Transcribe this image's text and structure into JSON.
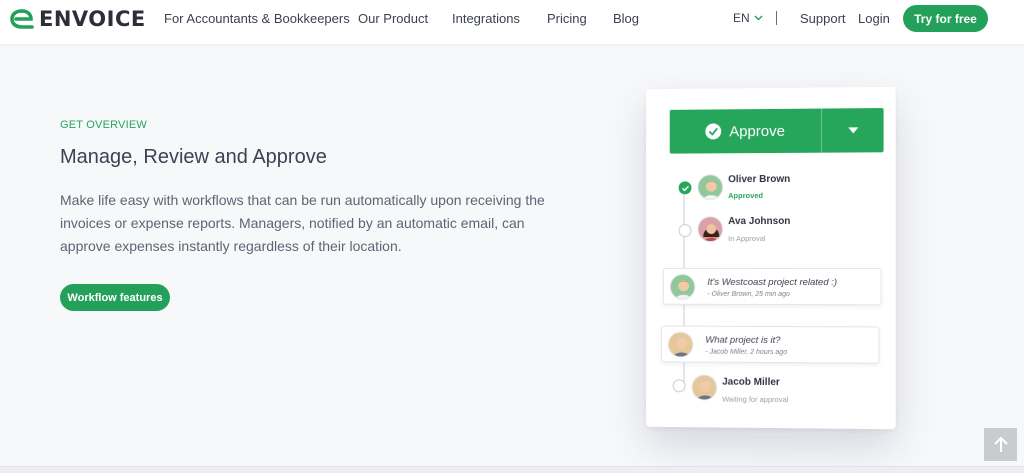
{
  "brand": {
    "name": "ENVOICE",
    "color": "#23a05a"
  },
  "nav": {
    "items": [
      "For Accountants & Bookkeepers",
      "Our Product",
      "Integrations",
      "Pricing",
      "Blog"
    ],
    "lang": "EN",
    "support": "Support",
    "login": "Login",
    "cta": "Try for free"
  },
  "hero": {
    "eyebrow": "GET OVERVIEW",
    "title": "Manage, Review and Approve",
    "description": "Make life easy with workflows that can be run automatically upon receiving the invoices or expense reports. Managers, notified by an automatic email, can approve expenses instantly regardless of their location.",
    "button": "Workflow features"
  },
  "card": {
    "approve_label": "Approve",
    "steps": [
      {
        "name": "Oliver Brown",
        "status": "Approved"
      },
      {
        "name": "Ava Johnson",
        "status": "In Approval"
      },
      {
        "name": "Jacob Miller",
        "status": "Waiting for approval"
      }
    ],
    "comments": [
      {
        "text": "It's Westcoast project related :)",
        "meta": "- Oliver Brown, 25 min ago"
      },
      {
        "text": "What project is it?",
        "meta": "- Jacob Miller, 2 hours ago"
      }
    ]
  }
}
